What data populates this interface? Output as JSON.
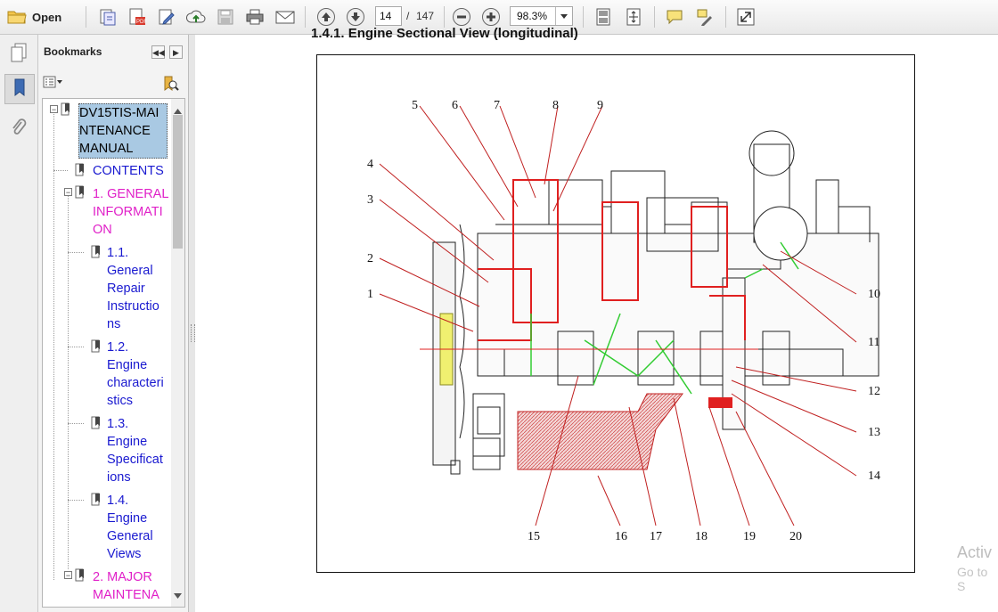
{
  "toolbar": {
    "open_label": "Open",
    "current_page": "14",
    "page_separator": "/",
    "total_pages": "147",
    "zoom": "98.3%"
  },
  "sidebar": {
    "title": "Bookmarks",
    "items": [
      {
        "label": "DV15TIS-MAI\nNTENANCE\nMANUAL",
        "color": "#000000",
        "selected": true
      },
      {
        "label": "CONTENTS",
        "color": "#1a1ad0"
      },
      {
        "label": "1. GENERAL\nINFORMATI\nON",
        "color": "#e020c8"
      },
      {
        "label": "1.1.\nGeneral\nRepair\nInstructio\nns",
        "color": "#1a1ad0"
      },
      {
        "label": "1.2.\nEngine\ncharacteri\nstics",
        "color": "#1a1ad0"
      },
      {
        "label": "1.3.\nEngine\nSpecificat\nions",
        "color": "#1a1ad0"
      },
      {
        "label": "1.4.\nEngine\nGeneral\nViews",
        "color": "#1a1ad0"
      },
      {
        "label": "2. MAJOR\nMAINTENA",
        "color": "#e020c8"
      }
    ]
  },
  "document": {
    "heading": "1.4.1. Engine Sectional View (longitudinal)",
    "callouts": [
      "1",
      "2",
      "3",
      "4",
      "5",
      "6",
      "7",
      "8",
      "9",
      "10",
      "11",
      "12",
      "13",
      "14",
      "15",
      "16",
      "17",
      "18",
      "19",
      "20"
    ]
  },
  "watermark": {
    "line1": "Activ",
    "line2": "Go to S"
  },
  "colors": {
    "accent_blue": "#1a1ad0",
    "accent_magenta": "#e020c8",
    "selection": "#a9c9e3",
    "drawing_red": "#e02020",
    "drawing_green": "#33cc33"
  }
}
